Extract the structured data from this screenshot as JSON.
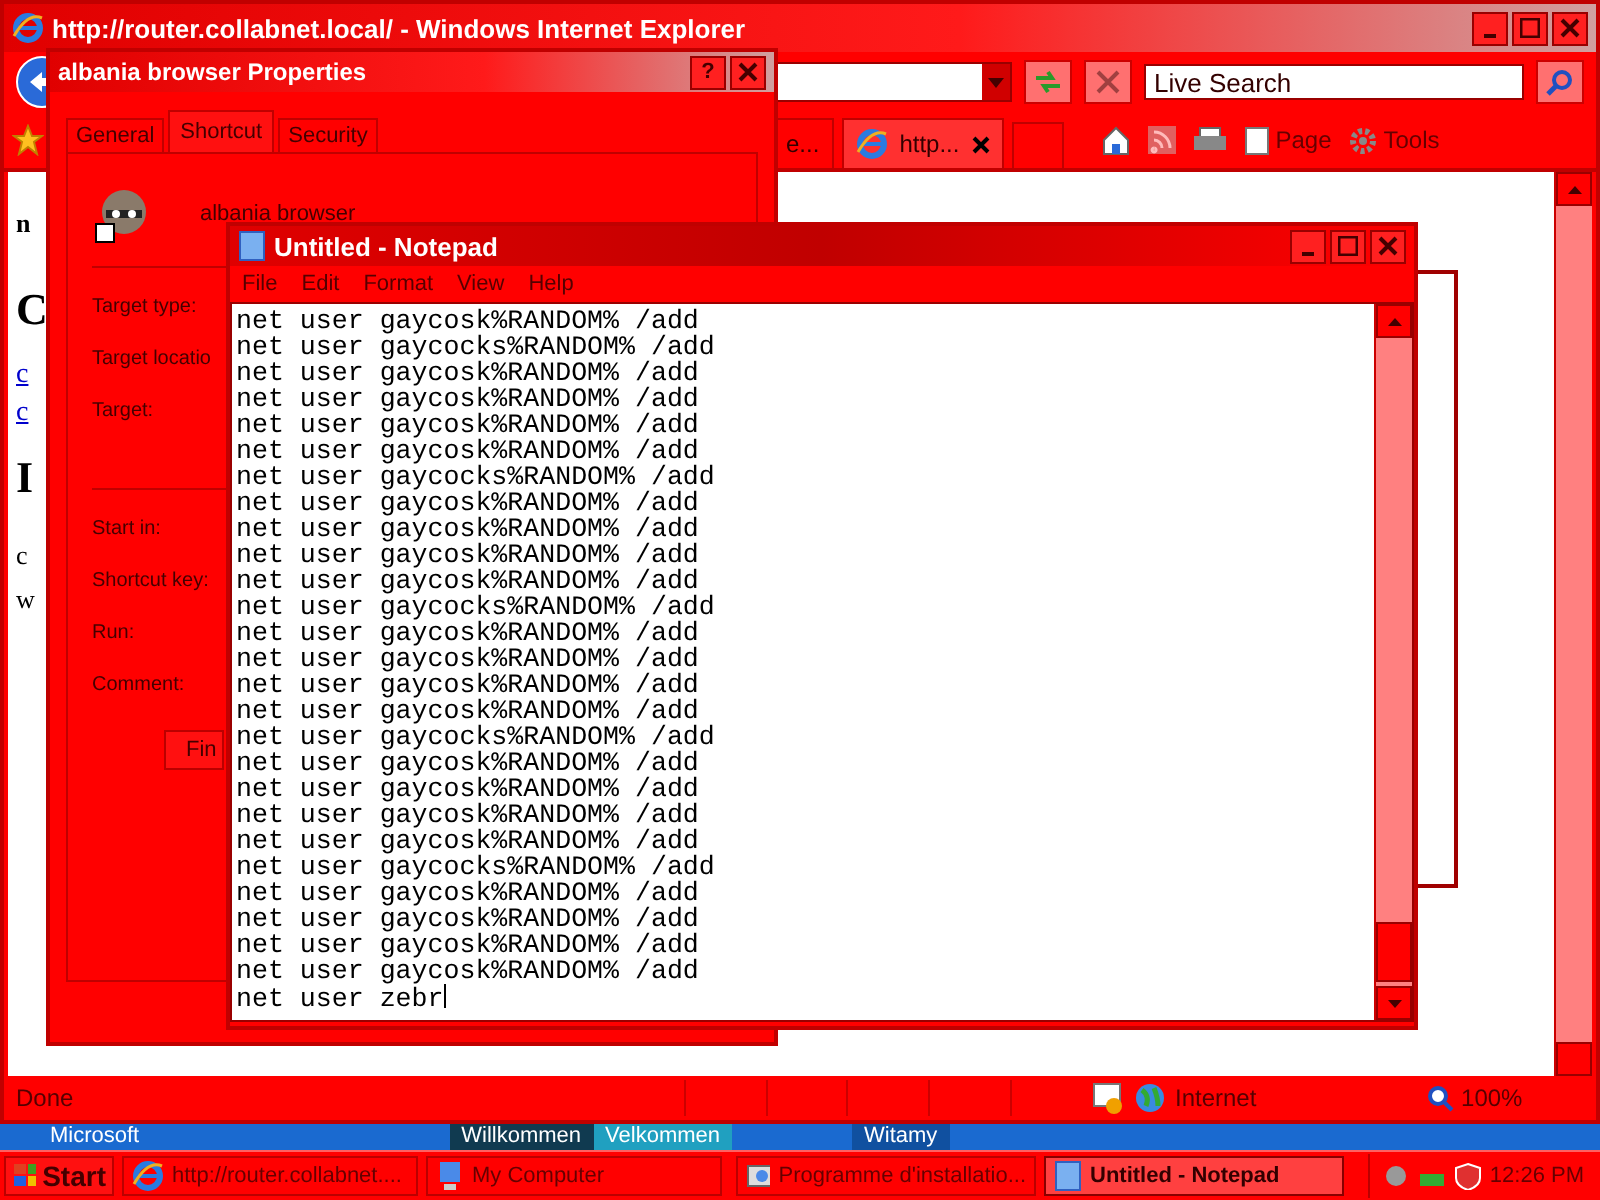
{
  "browser": {
    "title": "http://router.collabnet.local/ - Windows Internet Explorer",
    "search": {
      "placeholder": "Live Search"
    },
    "tabs": [
      {
        "label": "e...",
        "selected": false
      },
      {
        "label": "http...",
        "selected": true
      }
    ],
    "commands": [
      "Page",
      "Tools"
    ],
    "page_fragments": [
      {
        "text": "n",
        "kind": "bold"
      },
      {
        "text": "C",
        "kind": "heading"
      },
      {
        "text": "c",
        "kind": "link"
      },
      {
        "text": "c",
        "kind": "link"
      },
      {
        "text": "I",
        "kind": "heading"
      },
      {
        "text": "c",
        "kind": "plain"
      },
      {
        "text": "w",
        "kind": "plain"
      }
    ],
    "status_bar": {
      "text": "Done",
      "zone": "Internet",
      "zoom": "100%"
    }
  },
  "desktop_banner": [
    "Microsoft",
    "Willkommen",
    "Velkommen",
    "Witamy"
  ],
  "properties": {
    "title": "albania browser Properties",
    "help_button": "?",
    "tabs": [
      {
        "label": "General",
        "selected": false
      },
      {
        "label": "Shortcut",
        "selected": true
      },
      {
        "label": "Security",
        "selected": false
      }
    ],
    "name": "albania browser",
    "fields": [
      "Target type:",
      "Target locatio",
      "Target:",
      "Start in:",
      "Shortcut key:",
      "Run:",
      "Comment:"
    ],
    "button": "Fin"
  },
  "notepad": {
    "title": "Untitled - Notepad",
    "menu": [
      "File",
      "Edit",
      "Format",
      "View",
      "Help"
    ],
    "lines": [
      "net user gaycosk%RANDOM% /add",
      "net user gaycocks%RANDOM% /add",
      "net user gaycosk%RANDOM% /add",
      "net user gaycosk%RANDOM% /add",
      "net user gaycosk%RANDOM% /add",
      "net user gaycosk%RANDOM% /add",
      "net user gaycocks%RANDOM% /add",
      "net user gaycosk%RANDOM% /add",
      "net user gaycosk%RANDOM% /add",
      "net user gaycosk%RANDOM% /add",
      "net user gaycosk%RANDOM% /add",
      "net user gaycocks%RANDOM% /add",
      "net user gaycosk%RANDOM% /add",
      "net user gaycosk%RANDOM% /add",
      "net user gaycosk%RANDOM% /add",
      "net user gaycosk%RANDOM% /add",
      "net user gaycocks%RANDOM% /add",
      "net user gaycosk%RANDOM% /add",
      "net user gaycosk%RANDOM% /add",
      "net user gaycosk%RANDOM% /add",
      "net user gaycosk%RANDOM% /add",
      "net user gaycocks%RANDOM% /add",
      "net user gaycosk%RANDOM% /add",
      "net user gaycosk%RANDOM% /add",
      "net user gaycosk%RANDOM% /add",
      "net user gaycosk%RANDOM% /add",
      "net user zebr"
    ]
  },
  "taskbar": {
    "start": "Start",
    "tasks": [
      {
        "label": "http://router.collabnet....",
        "selected": false,
        "kind": "browser"
      },
      {
        "label": "My Computer",
        "selected": false,
        "kind": "computer"
      },
      {
        "label": "Programme d'installatio...",
        "selected": false,
        "kind": "installer"
      },
      {
        "label": "Untitled - Notepad",
        "selected": true,
        "kind": "notepad"
      }
    ],
    "clock": "12:26 PM"
  }
}
